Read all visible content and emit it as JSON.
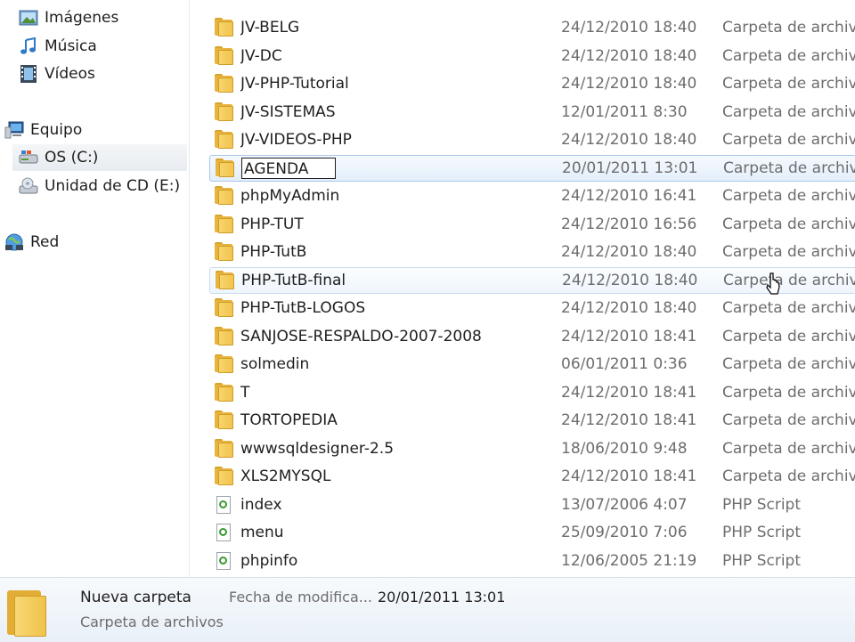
{
  "nav": {
    "items": [
      {
        "label": "Imágenes",
        "icon": "pictures-icon"
      },
      {
        "label": "Música",
        "icon": "music-icon"
      },
      {
        "label": "Vídeos",
        "icon": "videos-icon"
      },
      {
        "label": "Equipo",
        "icon": "computer-icon"
      },
      {
        "label": "OS (C:)",
        "icon": "drive-icon"
      },
      {
        "label": "Unidad de CD (E:)",
        "icon": "cd-drive-icon"
      },
      {
        "label": "Red",
        "icon": "network-icon"
      }
    ]
  },
  "files": [
    {
      "name": "JV-BELG",
      "date": "24/12/2010 18:40",
      "type": "Carpeta de archivos",
      "kind": "folder"
    },
    {
      "name": "JV-DC",
      "date": "24/12/2010 18:40",
      "type": "Carpeta de archivos",
      "kind": "folder"
    },
    {
      "name": "JV-PHP-Tutorial",
      "date": "24/12/2010 18:40",
      "type": "Carpeta de archivos",
      "kind": "folder"
    },
    {
      "name": "JV-SISTEMAS",
      "date": "12/01/2011 8:30",
      "type": "Carpeta de archivos",
      "kind": "folder"
    },
    {
      "name": "JV-VIDEOS-PHP",
      "date": "24/12/2010 18:40",
      "type": "Carpeta de archivos",
      "kind": "folder"
    },
    {
      "name": "AGENDA",
      "date": "20/01/2011 13:01",
      "type": "Carpeta de archivos",
      "kind": "folder"
    },
    {
      "name": "phpMyAdmin",
      "date": "24/12/2010 16:41",
      "type": "Carpeta de archivos",
      "kind": "folder"
    },
    {
      "name": "PHP-TUT",
      "date": "24/12/2010 16:56",
      "type": "Carpeta de archivos",
      "kind": "folder"
    },
    {
      "name": "PHP-TutB",
      "date": "24/12/2010 18:40",
      "type": "Carpeta de archivos",
      "kind": "folder"
    },
    {
      "name": "PHP-TutB-final",
      "date": "24/12/2010 18:40",
      "type": "Carpeta de archivos",
      "kind": "folder"
    },
    {
      "name": "PHP-TutB-LOGOS",
      "date": "24/12/2010 18:40",
      "type": "Carpeta de archivos",
      "kind": "folder"
    },
    {
      "name": "SANJOSE-RESPALDO-2007-2008",
      "date": "24/12/2010 18:41",
      "type": "Carpeta de archivos",
      "kind": "folder"
    },
    {
      "name": "solmedin",
      "date": "06/01/2011 0:36",
      "type": "Carpeta de archivos",
      "kind": "folder"
    },
    {
      "name": "T",
      "date": "24/12/2010 18:41",
      "type": "Carpeta de archivos",
      "kind": "folder"
    },
    {
      "name": "TORTOPEDIA",
      "date": "24/12/2010 18:41",
      "type": "Carpeta de archivos",
      "kind": "folder"
    },
    {
      "name": "wwwsqldesigner-2.5",
      "date": "18/06/2010 9:48",
      "type": "Carpeta de archivos",
      "kind": "folder"
    },
    {
      "name": "XLS2MYSQL",
      "date": "24/12/2010 18:41",
      "type": "Carpeta de archivos",
      "kind": "folder"
    },
    {
      "name": "index",
      "date": "13/07/2006 4:07",
      "type": "PHP Script",
      "kind": "php"
    },
    {
      "name": "menu",
      "date": "25/09/2010 7:06",
      "type": "PHP Script",
      "kind": "php"
    },
    {
      "name": "phpinfo",
      "date": "12/06/2005 21:19",
      "type": "PHP Script",
      "kind": "php"
    }
  ],
  "selected_row": 5,
  "hover_row": 9,
  "rename_value": "AGENDA",
  "details": {
    "name": "Nueva carpeta",
    "type": "Carpeta de archivos",
    "date_label": "Fecha de modifica...",
    "date_value": "20/01/2011 13:01"
  }
}
